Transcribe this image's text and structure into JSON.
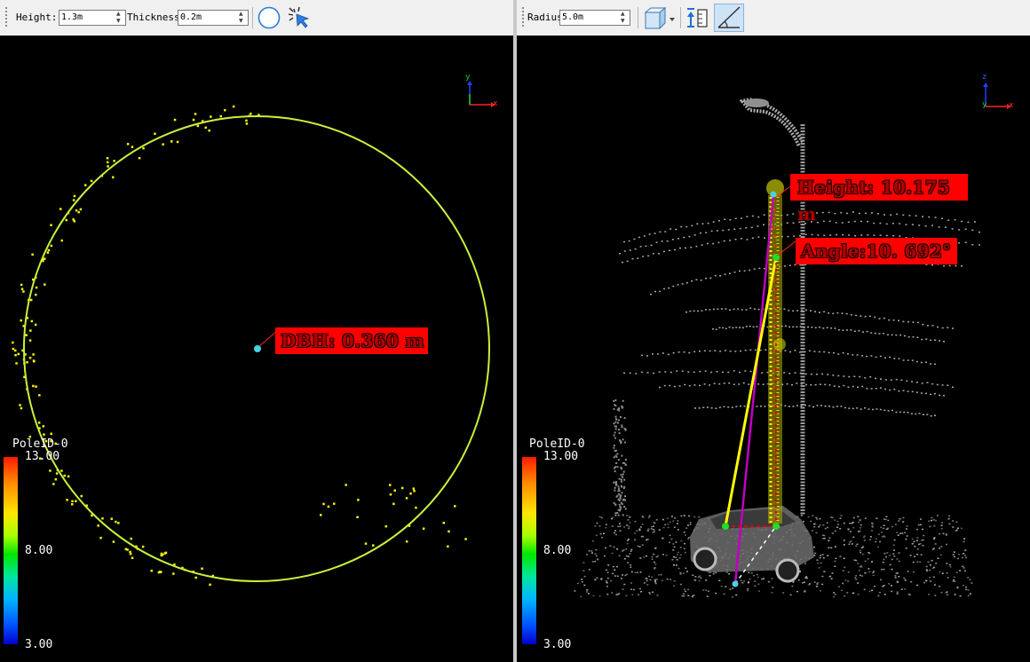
{
  "left_view": {
    "toolbar": {
      "height_label": "Height:",
      "height_value": "1.3m",
      "thickness_label": "Thickness",
      "thickness_value": "0.2m",
      "buttons": [
        "circle-fit-icon",
        "pick-pointer-icon"
      ]
    },
    "axis": {
      "vertical": "y",
      "horizontal": "x"
    },
    "annotation": "DBH: 0.360 m",
    "legend": {
      "title": "PoleID-0",
      "max": "13.00",
      "mid": "8.00",
      "min": "3.00"
    },
    "colors": {
      "fit_circle": "#c8f03c",
      "points": "#f4f400",
      "center": "#46d2e6",
      "label_bg": "#ff0000"
    }
  },
  "right_view": {
    "toolbar": {
      "radius_label": "Radius",
      "radius_value": "5.0m",
      "buttons": [
        "view-cube-icon",
        "height-measure-icon",
        "angle-measure-icon"
      ]
    },
    "axis": {
      "vertical": "z",
      "depth": "y",
      "horizontal": "x"
    },
    "annotations": {
      "height": "Height: 10.175 m",
      "angle": "Angle:10. 692°"
    },
    "legend": {
      "title": "PoleID-0",
      "max": "13.00",
      "mid": "8.00",
      "min": "3.00"
    },
    "colors": {
      "height_line": "#c000c0",
      "angle_line": "#ffff00",
      "markers": "#22dd22",
      "label_bg": "#ff0000"
    }
  }
}
